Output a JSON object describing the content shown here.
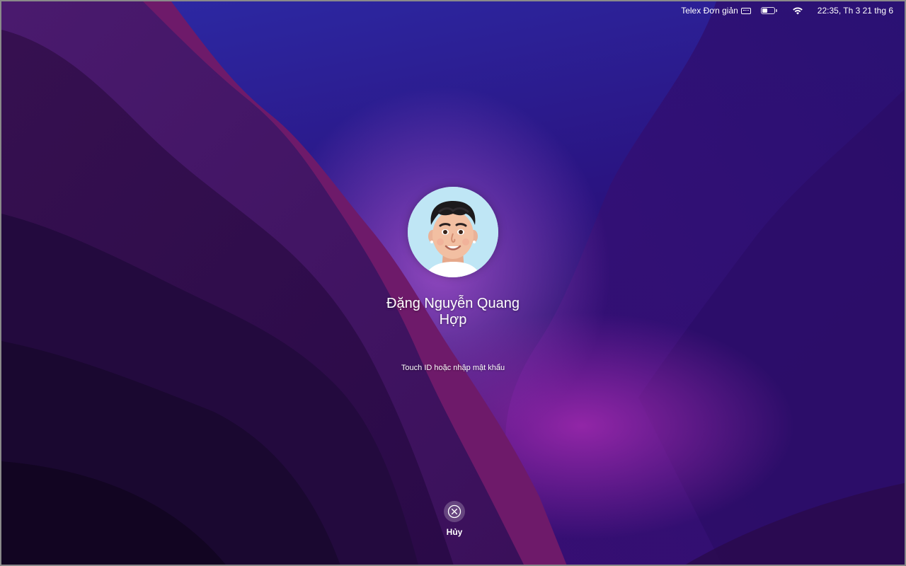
{
  "menubar": {
    "input_source": "Telex Đơn giản",
    "datetime": "22:35, Th 3 21 thg 6",
    "battery_level": 0.45,
    "icons": [
      "keyboard-icon",
      "battery-icon",
      "wifi-icon"
    ]
  },
  "login": {
    "user_name": "Đặng Nguyễn Quang Hợp",
    "hint": "Touch ID hoặc nhập mật khẩu",
    "avatar_icon": "memoji-avatar"
  },
  "cancel": {
    "label": "Hủy",
    "icon": "close-circle-icon"
  },
  "colors": {
    "wallpaper_top": "#2a1a8a",
    "wallpaper_magenta": "#8a1e9a",
    "wallpaper_dark": "#12082a",
    "avatar_bg": "#bfe6f5"
  }
}
